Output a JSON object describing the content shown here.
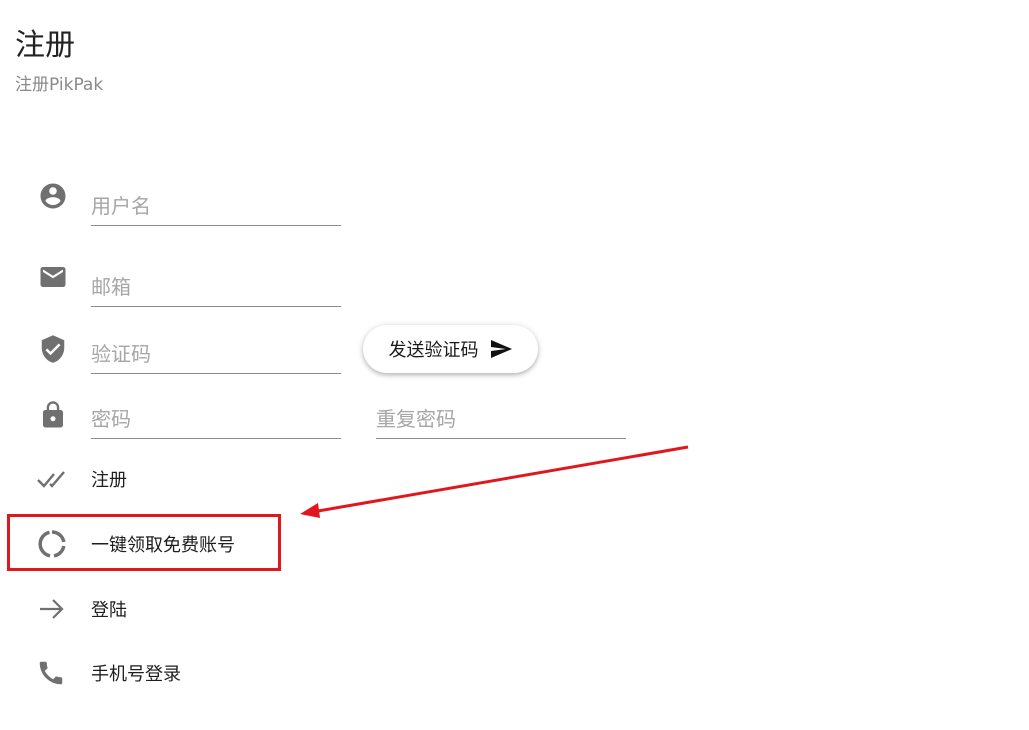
{
  "header": {
    "title": "注册",
    "subtitle": "注册PikPak"
  },
  "form": {
    "username": {
      "placeholder": "用户名",
      "value": ""
    },
    "email": {
      "placeholder": "邮箱",
      "value": ""
    },
    "code": {
      "placeholder": "验证码",
      "value": ""
    },
    "send_code_label": "发送验证码",
    "password": {
      "placeholder": "密码",
      "value": ""
    },
    "password_confirm": {
      "placeholder": "重复密码",
      "value": ""
    }
  },
  "actions": [
    {
      "label": "注册",
      "icon": "double-check-icon"
    },
    {
      "label": "一键领取免费账号",
      "icon": "loading-circle-icon"
    },
    {
      "label": "登陆",
      "icon": "arrow-right-icon"
    },
    {
      "label": "手机号登录",
      "icon": "phone-icon"
    }
  ],
  "icons": {
    "username": "account-circle-icon",
    "email": "mail-icon",
    "code": "verified-shield-icon",
    "password": "lock-icon",
    "send": "send-icon"
  },
  "colors": {
    "icon": "#707070",
    "highlight": "#e0181e",
    "underline": "#8c8c8c",
    "placeholder": "#a6a6a6"
  }
}
